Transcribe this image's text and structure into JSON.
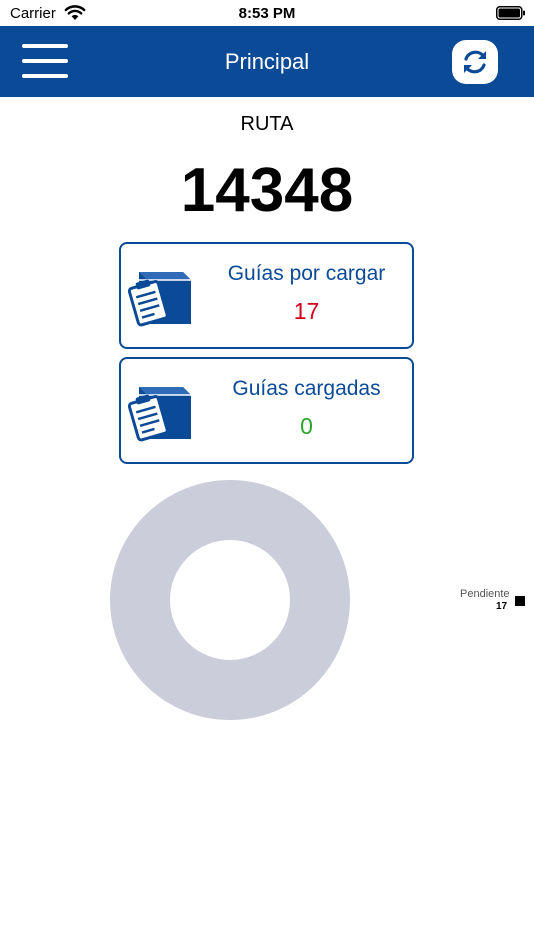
{
  "status_bar": {
    "carrier": "Carrier",
    "time": "8:53 PM"
  },
  "nav": {
    "title": "Principal",
    "menu_icon": "hamburger-menu-icon",
    "refresh_icon": "refresh-icon"
  },
  "route": {
    "label": "RUTA",
    "number": "14348"
  },
  "cards": [
    {
      "title": "Guías por cargar",
      "count": "17",
      "icon": "box-clipboard-icon",
      "count_color": "#d0021b"
    },
    {
      "title": "Guías cargadas",
      "count": "0",
      "icon": "box-clipboard-icon",
      "count_color": "#2aa52a"
    }
  ],
  "colors": {
    "primary": "#0b4a97",
    "donut": "#cbcdda"
  },
  "chart_data": {
    "type": "pie",
    "style": "donut",
    "categories": [
      "Pendiente"
    ],
    "values": [
      17
    ],
    "legend": "right"
  }
}
